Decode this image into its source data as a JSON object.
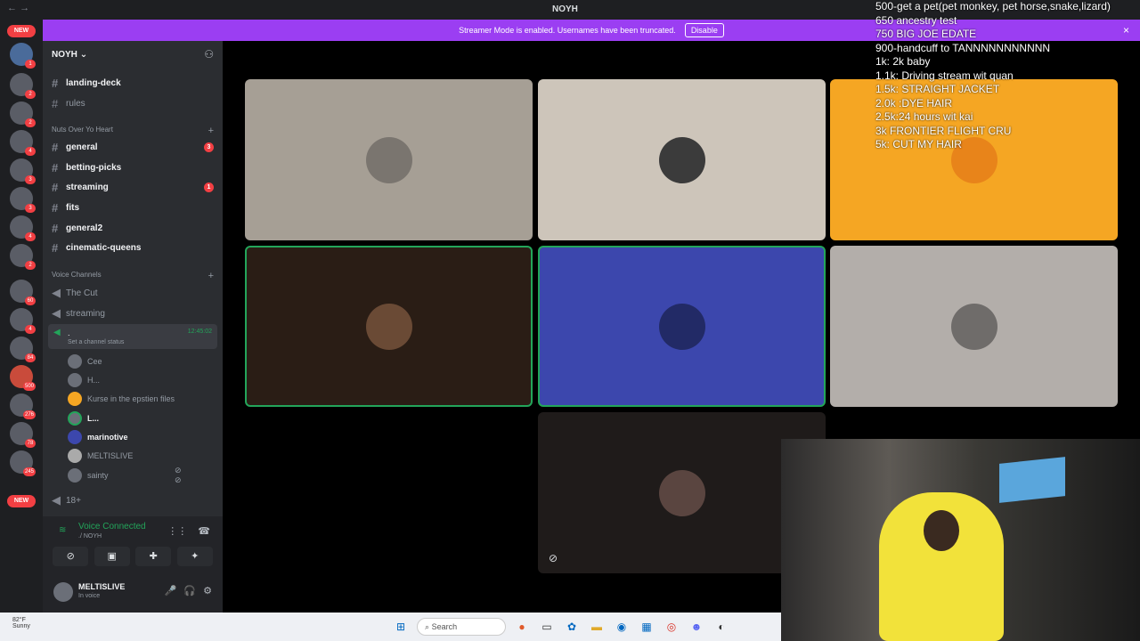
{
  "titlebar": {
    "back": "←",
    "forward": "→",
    "title": "NOYH"
  },
  "banner": {
    "text": "Streamer Mode is enabled. Usernames have been truncated.",
    "button": "Disable",
    "close": "×"
  },
  "servers": {
    "new_badge": "NEW",
    "badges": [
      "1",
      "2",
      "2",
      "4",
      "3",
      "3",
      "4",
      "2",
      "60",
      "4",
      "84",
      "500",
      "276",
      "78",
      "245"
    ]
  },
  "sidebar": {
    "guild_name": "NOYH",
    "top_channels": [
      {
        "name": "landing-deck",
        "bold": true
      },
      {
        "name": "rules",
        "bold": false
      }
    ],
    "category1": "Nuts Over Yo Heart",
    "channels": [
      {
        "name": "general",
        "bold": true,
        "count": "3"
      },
      {
        "name": "betting-picks",
        "bold": true,
        "count": ""
      },
      {
        "name": "streaming",
        "bold": true,
        "count": "1"
      },
      {
        "name": "fits",
        "bold": true,
        "count": ""
      },
      {
        "name": "general2",
        "bold": true,
        "count": ""
      },
      {
        "name": "cinematic-queens",
        "bold": true,
        "count": ""
      }
    ],
    "voice_category": "Voice Channels",
    "voice_channels": [
      {
        "name": "The Cut"
      },
      {
        "name": "streaming"
      }
    ],
    "active_voice": {
      "name": ".",
      "time": "12:45:02",
      "status": "Set a channel status"
    },
    "voice_users": [
      {
        "name": "Cee",
        "bold": false
      },
      {
        "name": "H...",
        "bold": false
      },
      {
        "name": "Kurse in the epstien files",
        "bold": false
      },
      {
        "name": "L...",
        "bold": true
      },
      {
        "name": "marinotive",
        "bold": true
      },
      {
        "name": "MELTISLIVE",
        "bold": false
      },
      {
        "name": "sainty",
        "bold": false
      }
    ],
    "channel_18": "18+"
  },
  "voice_panel": {
    "title": "Voice Connected",
    "sub": "./ NOYH"
  },
  "user": {
    "name": "MELTISLIVE",
    "status": "In voice"
  },
  "overlay_lines": [
    "500-get a pet(pet monkey, pet horse,snake,lizard)",
    "650 ancestry test",
    "750 BIG JOE EDATE",
    "900-handcuff to TANNNNNNNNNNN",
    "1k: 2k baby",
    "1.1k: Driving stream wit quan",
    "1.5k: STRAIGHT JACKET",
    "2.0k :DYE HAIR",
    "2.5k:24 hours wit kai",
    "3k FRONTIER FLIGHT CRU",
    "5k: CUT MY HAIR"
  ],
  "taskbar": {
    "temp": "82°F",
    "weather": "Sunny",
    "search": "Search"
  },
  "colors": {
    "banner": "#9b3ef2",
    "speaking": "#23a55a",
    "tile_orange": "#f5a623",
    "tile_blue": "#3c47ad"
  }
}
